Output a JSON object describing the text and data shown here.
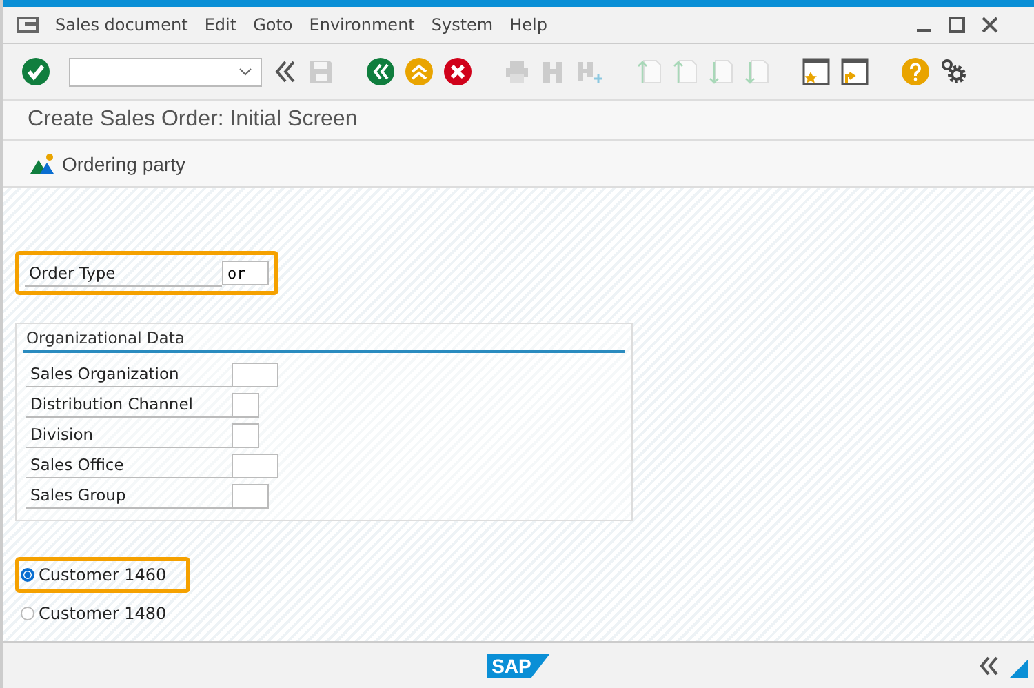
{
  "menu": [
    "Sales document",
    "Edit",
    "Goto",
    "Environment",
    "System",
    "Help"
  ],
  "title": "Create Sales Order: Initial Screen",
  "app_toolbar": {
    "button": "Ordering party"
  },
  "order_type": {
    "label": "Order Type",
    "value": "or",
    "highlighted": true
  },
  "org_data": {
    "title": "Organizational Data",
    "fields": [
      {
        "label": "Sales Organization"
      },
      {
        "label": "Distribution Channel"
      },
      {
        "label": "Division"
      },
      {
        "label": "Sales Office"
      },
      {
        "label": "Sales Group"
      }
    ]
  },
  "customers": [
    {
      "label": "Customer 1460",
      "selected": true,
      "highlighted": true
    },
    {
      "label": "Customer 1480",
      "selected": false,
      "highlighted": false
    }
  ],
  "status_bar": {
    "logo": "SAP"
  }
}
